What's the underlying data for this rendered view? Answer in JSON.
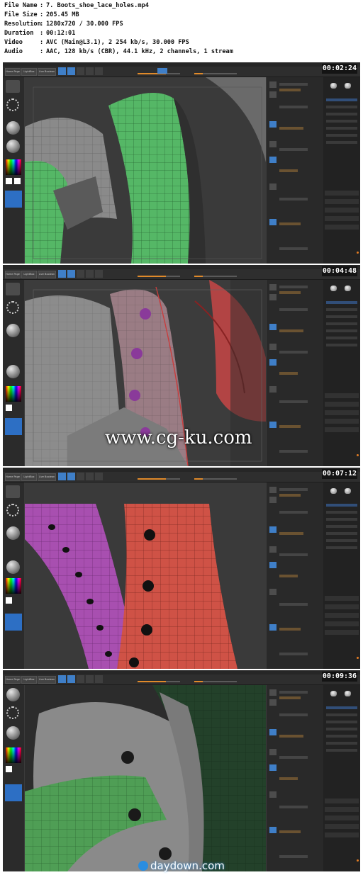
{
  "metadata": [
    {
      "key": "File Name",
      "value": "7. Boots_shoe_lace_holes.mp4"
    },
    {
      "key": "File Size",
      "value": "205.45 MB"
    },
    {
      "key": "Resolution",
      "value": "1280x720 / 30.000 FPS"
    },
    {
      "key": "Duration",
      "value": "00:12:01"
    },
    {
      "key": "Video",
      "value": "AVC (Main@L3.1), 2 254 kb/s, 30.000 FPS"
    },
    {
      "key": "Audio",
      "value": "AAC, 128 kb/s (CBR), 44.1 kHz, 2 channels, 1 stream"
    }
  ],
  "separator": ":",
  "frames": [
    {
      "timestamp": "00:02:24",
      "theme": "green"
    },
    {
      "timestamp": "00:04:48",
      "theme": "gray-pink"
    },
    {
      "timestamp": "00:07:12",
      "theme": "purple-red"
    },
    {
      "timestamp": "00:09:36",
      "theme": "green-dark"
    }
  ],
  "toolbar": {
    "home_label": "Home Page",
    "lightbox_label": "LightBox",
    "liveboolean_label": "Live Boolean"
  },
  "watermarks": {
    "primary": "www.cg-ku.com",
    "secondary": "daydown.com"
  },
  "colors": {
    "accent": "#3f7fc8",
    "orange": "#e08a2a",
    "green_mesh": "#4fae5b",
    "purple_mesh": "#a64fa8",
    "red_mesh": "#c84a3f"
  }
}
